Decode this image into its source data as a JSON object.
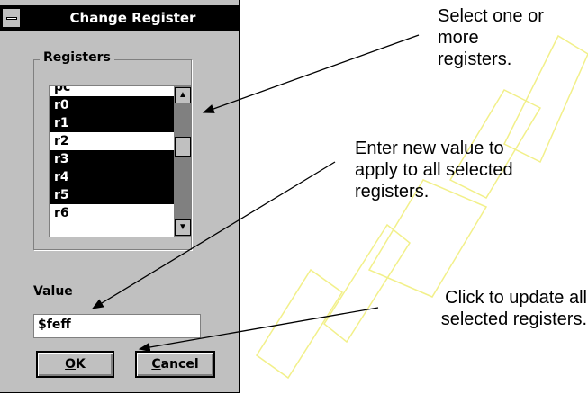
{
  "dialog": {
    "title": "Change Register",
    "registers_group_label": "Registers",
    "register_list": [
      {
        "name": "pc",
        "selected": false
      },
      {
        "name": "r0",
        "selected": true
      },
      {
        "name": "r1",
        "selected": true
      },
      {
        "name": "r2",
        "selected": false
      },
      {
        "name": "r3",
        "selected": true
      },
      {
        "name": "r4",
        "selected": true
      },
      {
        "name": "r5",
        "selected": true
      },
      {
        "name": "r6",
        "selected": false
      }
    ],
    "scroll_up_glyph": "▲",
    "scroll_down_glyph": "▼",
    "value_label": "Value",
    "value_input": "$feff",
    "ok_label": {
      "mnemonic": "O",
      "rest": "K"
    },
    "cancel_label": {
      "mnemonic": "C",
      "rest": "ancel"
    }
  },
  "annotations": {
    "select_registers": [
      "Select one or",
      "more",
      "registers."
    ],
    "enter_value": [
      "Enter new value to",
      "apply to all selected",
      "registers."
    ],
    "click_update": [
      "Click to update all",
      "selected registers."
    ]
  },
  "colors": {
    "dialog_bg": "#c0c0c0",
    "titlebar": "#000000",
    "selection": "#000000",
    "watermark": "#ffff99"
  }
}
